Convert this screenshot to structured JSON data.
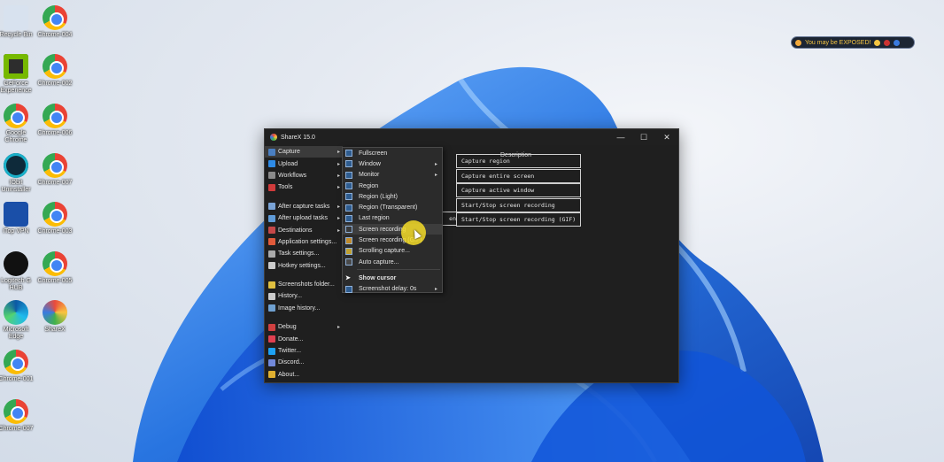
{
  "desktop": {
    "icons": [
      {
        "label": "Recycle Bin",
        "kind": "recycle"
      },
      {
        "label": "Chrome-004",
        "kind": "chrome"
      },
      {
        "label": "GeForce Experience",
        "kind": "geforce"
      },
      {
        "label": "Chrome-002",
        "kind": "chrome"
      },
      {
        "label": "Google Chrome",
        "kind": "chrome"
      },
      {
        "label": "Chrome-006",
        "kind": "chrome"
      },
      {
        "label": "IObit Uninstaller",
        "kind": "iobit"
      },
      {
        "label": "Chrome-007",
        "kind": "chrome"
      },
      {
        "label": "iTop VPN",
        "kind": "vpn"
      },
      {
        "label": "Chrome-003",
        "kind": "chrome"
      },
      {
        "label": "Logitech G HUB",
        "kind": "logitech"
      },
      {
        "label": "Chrome-005",
        "kind": "chrome"
      },
      {
        "label": "Microsoft Edge",
        "kind": "edge"
      },
      {
        "label": "ShareX",
        "kind": "sharex"
      },
      {
        "label": "Chrome-001",
        "kind": "chrome"
      },
      {
        "label": "Chrome-007",
        "kind": "chrome"
      }
    ]
  },
  "exposed_badge": {
    "text": "You may be EXPOSED!"
  },
  "window": {
    "title": "ShareX 15.0",
    "controls": {
      "minimize": "—",
      "maximize": "☐",
      "close": "✕"
    }
  },
  "main_menu": [
    {
      "label": "Capture",
      "submenu": true,
      "color": "#4a7fc1",
      "selected": true
    },
    {
      "label": "Upload",
      "submenu": true,
      "color": "#2e8be6"
    },
    {
      "label": "Workflows",
      "submenu": true,
      "color": "#8a8a8a"
    },
    {
      "label": "Tools",
      "submenu": true,
      "color": "#d03b3b"
    },
    {
      "sep": true
    },
    {
      "label": "After capture tasks",
      "submenu": true,
      "color": "#7aa3d6"
    },
    {
      "label": "After upload tasks",
      "submenu": true,
      "color": "#5f9bd8"
    },
    {
      "label": "Destinations",
      "submenu": true,
      "color": "#c54848"
    },
    {
      "label": "Application settings...",
      "color": "#e05a3a"
    },
    {
      "label": "Task settings...",
      "color": "#aaaaaa"
    },
    {
      "label": "Hotkey settings...",
      "color": "#cccccc"
    },
    {
      "sep": true
    },
    {
      "label": "Screenshots folder...",
      "color": "#e0c040"
    },
    {
      "label": "History...",
      "color": "#cccccc"
    },
    {
      "label": "Image history...",
      "color": "#6fa0d0"
    },
    {
      "sep": true
    },
    {
      "label": "Debug",
      "submenu": true,
      "color": "#d04040"
    },
    {
      "label": "Donate...",
      "color": "#e04050"
    },
    {
      "label": "Twitter...",
      "color": "#1da1f2"
    },
    {
      "label": "Discord...",
      "color": "#7289da"
    },
    {
      "label": "About...",
      "color": "#e0b030"
    }
  ],
  "capture_submenu": [
    {
      "label": "Fullscreen"
    },
    {
      "label": "Window",
      "submenu": true
    },
    {
      "label": "Monitor",
      "submenu": true
    },
    {
      "label": "Region"
    },
    {
      "label": "Region (Light)"
    },
    {
      "label": "Region (Transparent)"
    },
    {
      "label": "Last region"
    },
    {
      "label": "Screen recording",
      "highlight": true
    },
    {
      "label": "Screen recording (GIF)"
    },
    {
      "label": "Scrolling capture..."
    },
    {
      "label": "Auto capture..."
    },
    {
      "sep": true
    },
    {
      "label": "Show cursor",
      "bold": true
    },
    {
      "label": "Screenshot delay: 0s",
      "submenu": true
    }
  ],
  "hotkey_list": {
    "header": "Description",
    "left_partial": "en",
    "rows": [
      "Capture region",
      "Capture entire screen",
      "Capture active window",
      "Start/Stop screen recording",
      "Start/Stop screen recording (GIF)"
    ]
  }
}
